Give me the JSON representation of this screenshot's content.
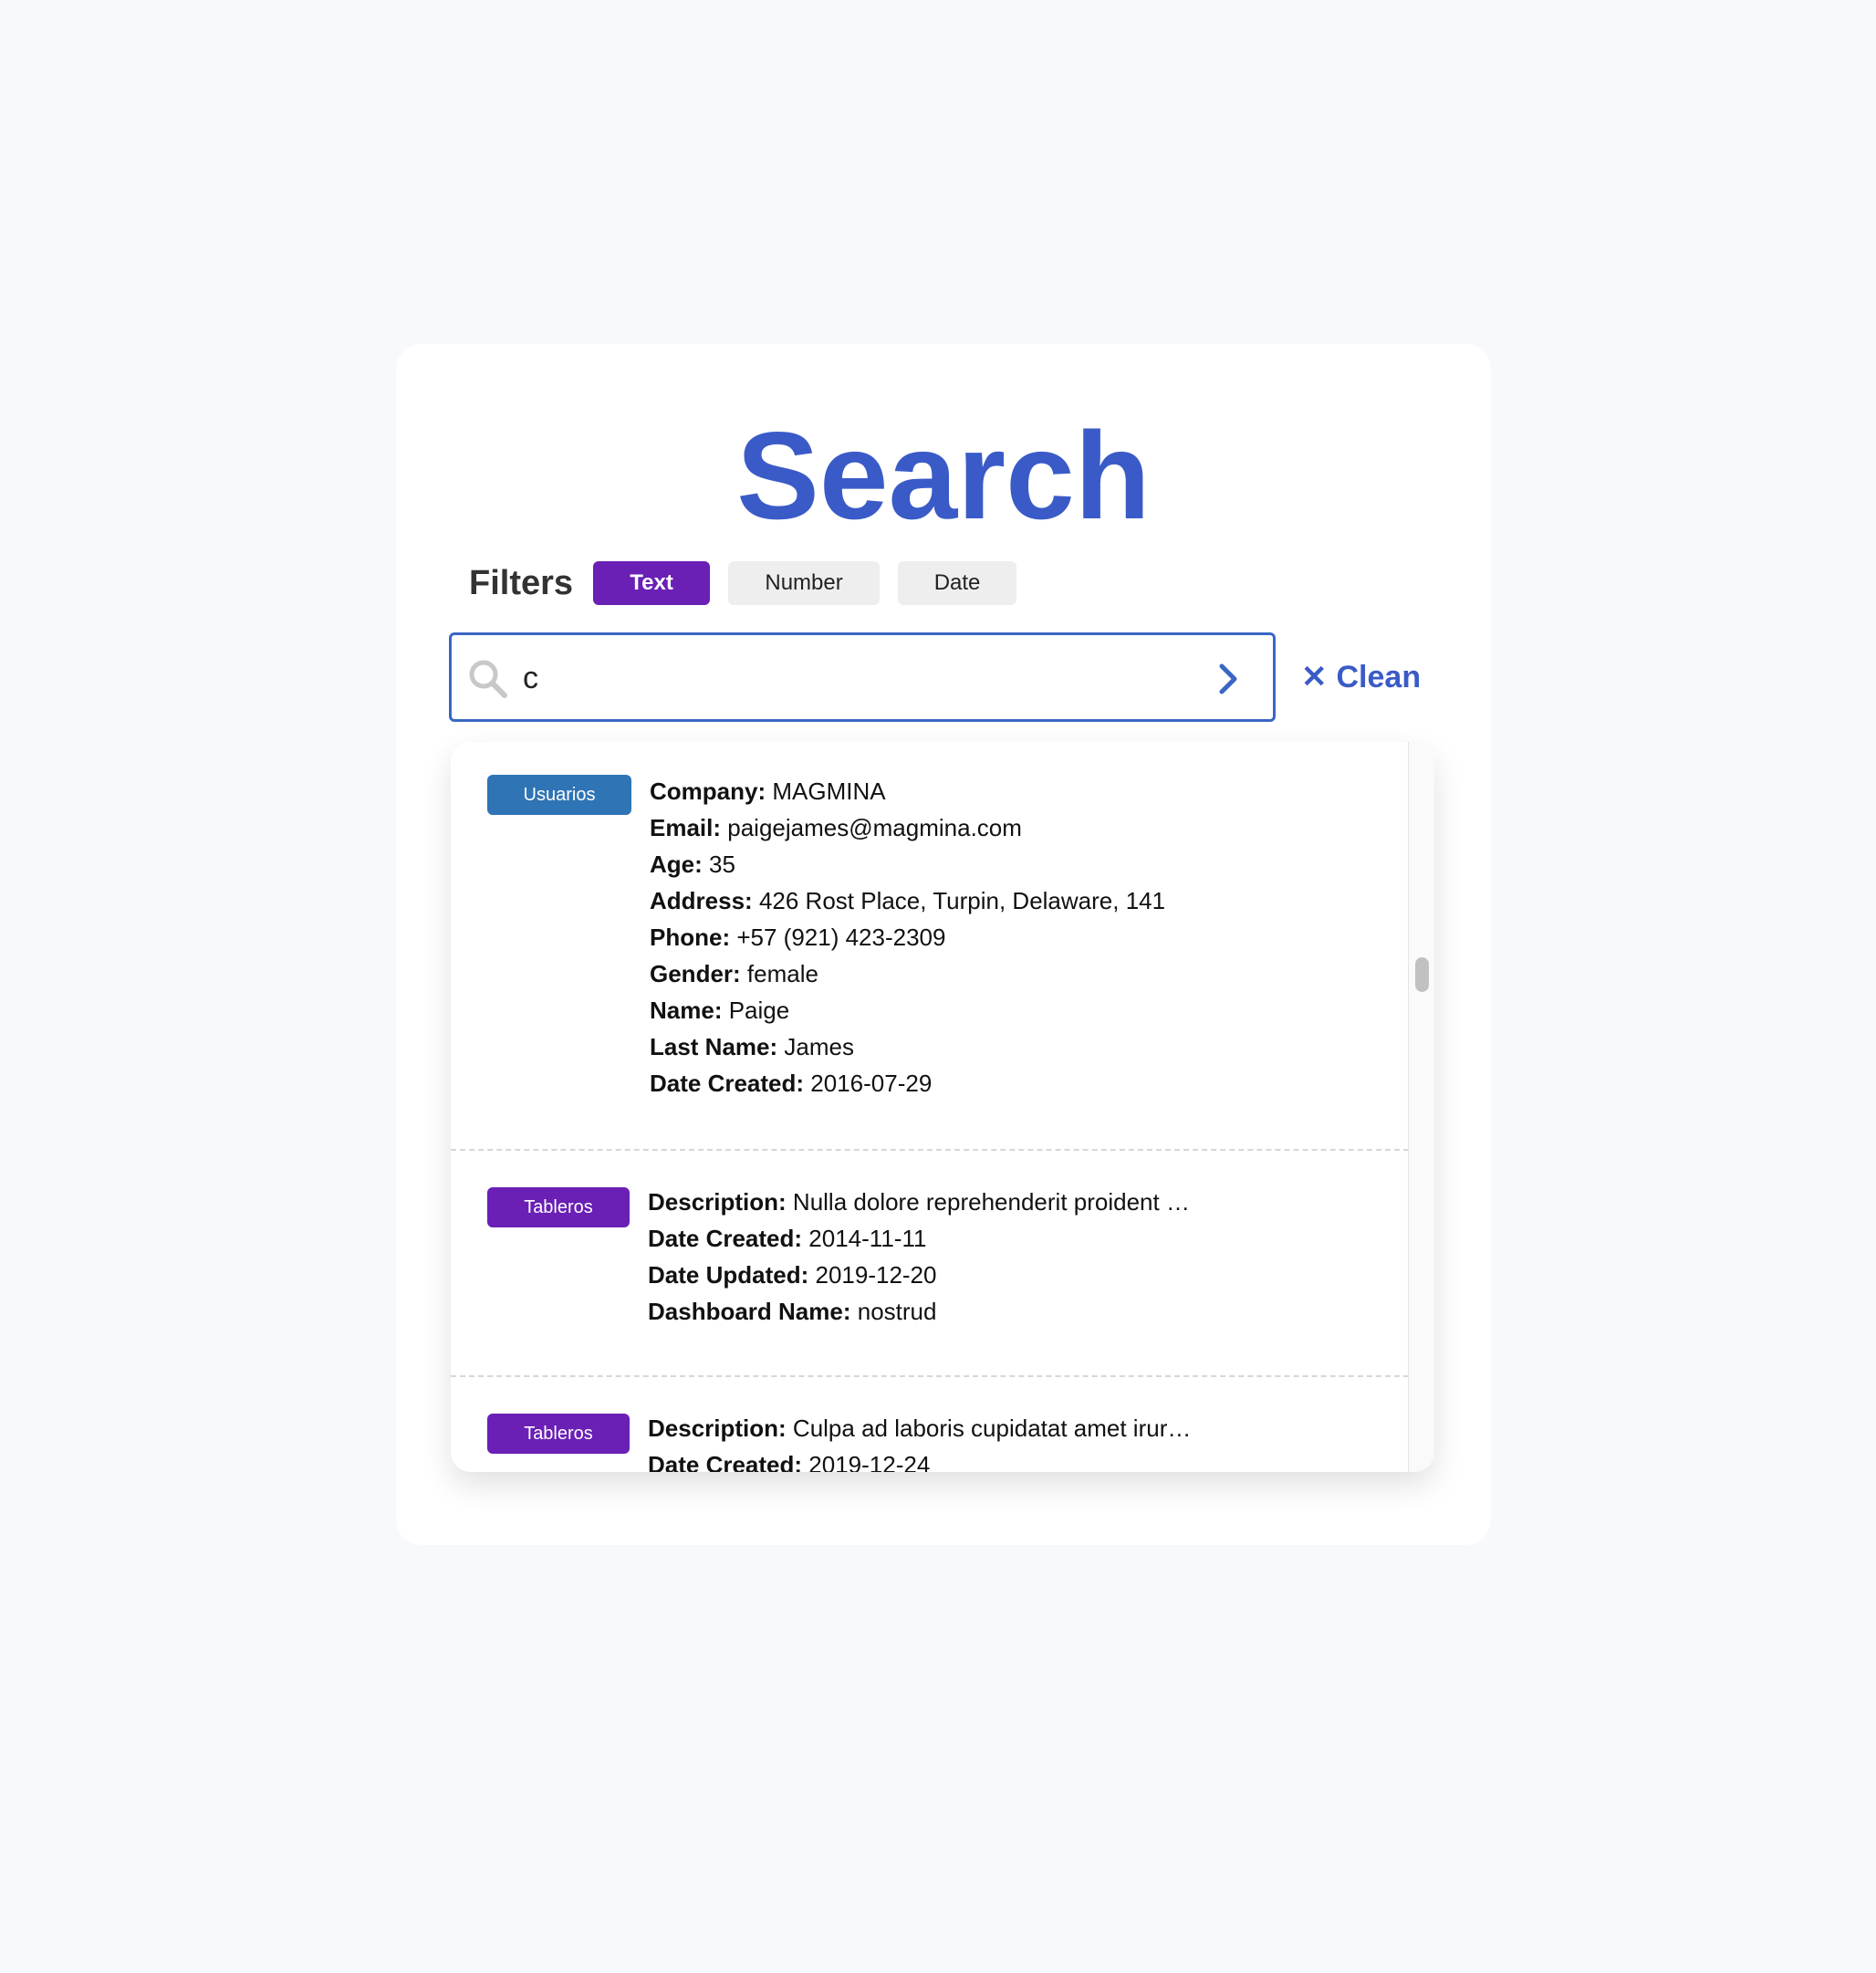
{
  "title": "Search",
  "filters": {
    "label": "Filters",
    "options": [
      {
        "label": "Text",
        "active": true
      },
      {
        "label": "Number",
        "active": false
      },
      {
        "label": "Date",
        "active": false
      }
    ]
  },
  "search": {
    "value": "c"
  },
  "clean_label": "Clean",
  "colors": {
    "accent": "#3a5bc7",
    "usuarios_tag": "#2f74b5",
    "tableros_tag": "#6a1fb5"
  },
  "results": [
    {
      "tag": "Usuarios",
      "fields": [
        {
          "key": "Company:",
          "value": "MAGMINA"
        },
        {
          "key": "Email:",
          "value": "paigejames@magmina.com"
        },
        {
          "key": "Age:",
          "value": "35"
        },
        {
          "key": "Address:",
          "value": "426 Rost Place, Turpin, Delaware, 141"
        },
        {
          "key": "Phone:",
          "value": "+57 (921) 423-2309"
        },
        {
          "key": "Gender:",
          "value": "female"
        },
        {
          "key": "Name:",
          "value": "Paige"
        },
        {
          "key": "Last Name:",
          "value": "James"
        },
        {
          "key": "Date Created:",
          "value": "2016-07-29"
        }
      ]
    },
    {
      "tag": "Tableros",
      "fields": [
        {
          "key": "Description:",
          "value": "Nulla dolore reprehenderit proident …"
        },
        {
          "key": "Date Created:",
          "value": "2014-11-11"
        },
        {
          "key": "Date Updated:",
          "value": "2019-12-20"
        },
        {
          "key": "Dashboard Name:",
          "value": "nostrud"
        }
      ]
    },
    {
      "tag": "Tableros",
      "fields": [
        {
          "key": "Description:",
          "value": "Culpa ad laboris cupidatat amet irur…"
        },
        {
          "key": "Date Created:",
          "value": "2019-12-24"
        }
      ]
    }
  ]
}
